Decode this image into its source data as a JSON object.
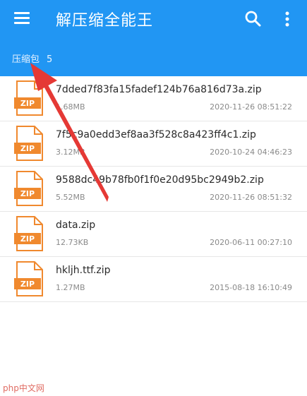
{
  "app": {
    "title": "解压缩全能王"
  },
  "icons": {
    "menu": "hamburger-menu-icon",
    "search": "search-icon",
    "more": "more-vert-icon",
    "file": "zip-file-icon"
  },
  "crumb": {
    "label": "压缩包",
    "count": "5"
  },
  "files": [
    {
      "name": "7dded7f83fa15fadef124b76a816d73a.zip",
      "size": "1.68MB",
      "date": "2020-11-26 08:51:22"
    },
    {
      "name": "7f5c9a0edd3ef8aa3f528c8a423ff4c1.zip",
      "size": "3.12MB",
      "date": "2020-10-24 04:46:23"
    },
    {
      "name": "9588dc49b78fb0f1f0e20d95bc2949b2.zip",
      "size": "5.52MB",
      "date": "2020-11-26 08:51:32"
    },
    {
      "name": "data.zip",
      "size": "12.73KB",
      "date": "2020-06-11 00:27:10"
    },
    {
      "name": "hkljh.ttf.zip",
      "size": "1.27MB",
      "date": "2015-08-18 16:10:49"
    }
  ],
  "badge": "ZIP",
  "watermark": "php中文网",
  "colors": {
    "appbar": "#2196f3",
    "zip_orange": "#f0892e",
    "arrow": "#e53935"
  }
}
